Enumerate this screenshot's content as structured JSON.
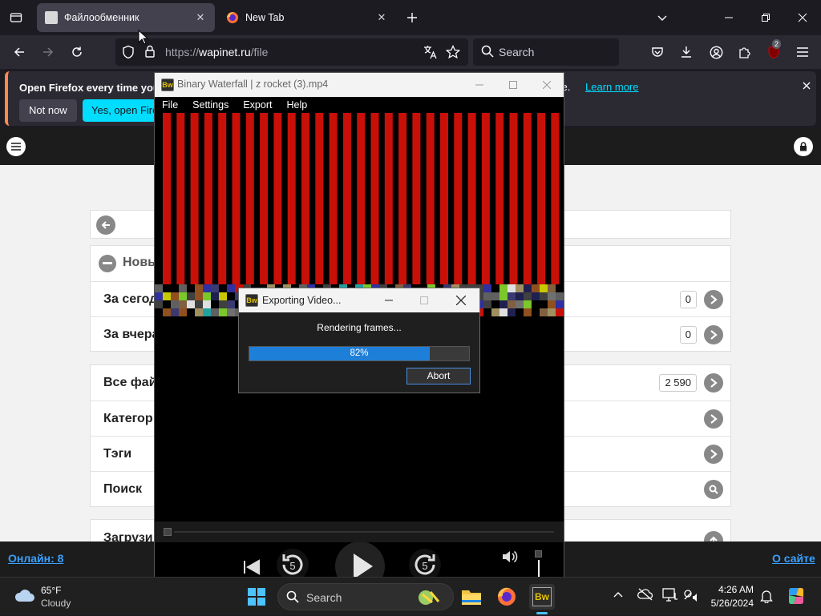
{
  "browser": {
    "tabs": [
      {
        "label": "Файлообменник",
        "active": true
      },
      {
        "label": "New Tab",
        "active": false
      }
    ],
    "url_prefix": "https://",
    "url_domain": "wapinet.ru",
    "url_path": "/file",
    "search_placeholder": "Search",
    "extension_badge": "2"
  },
  "notification": {
    "message": "Open Firefox every time you re",
    "tail": "ce.",
    "learn_more": "Learn more",
    "not_now": "Not now",
    "yes_open": "Yes, open Firefox"
  },
  "site": {
    "rows": [
      {
        "label": "Новы",
        "count": ""
      },
      {
        "label": "За сегод",
        "count": "0"
      },
      {
        "label": "За вчера",
        "count": "0"
      },
      {
        "label": "Все фай",
        "count": "2 590"
      },
      {
        "label": "Категор",
        "count": ""
      },
      {
        "label": "Тэги",
        "count": ""
      },
      {
        "label": "Поиск",
        "count": ""
      },
      {
        "label": "Загрузи",
        "count": ""
      }
    ],
    "footer_online": "Онлайн: 8",
    "footer_about": "О сайте"
  },
  "app": {
    "title": "Binary Waterfall | z rocket (3).mp4",
    "icon_text": "Bw",
    "menu": [
      "File",
      "Settings",
      "Export",
      "Help"
    ]
  },
  "export_dialog": {
    "title": "Exporting Video...",
    "status": "Rendering frames...",
    "progress_label": "82%",
    "progress": 0.82,
    "abort_label": "Abort"
  },
  "taskbar": {
    "weather_temp": "65°F",
    "weather_cond": "Cloudy",
    "search_placeholder": "Search",
    "time": "4:26 AM",
    "date": "5/26/2024"
  },
  "colors": {
    "accent": "#00ddff",
    "progress": "#1e7fd8",
    "link": "#3aa0ff",
    "stripe_red": "#c81008"
  }
}
